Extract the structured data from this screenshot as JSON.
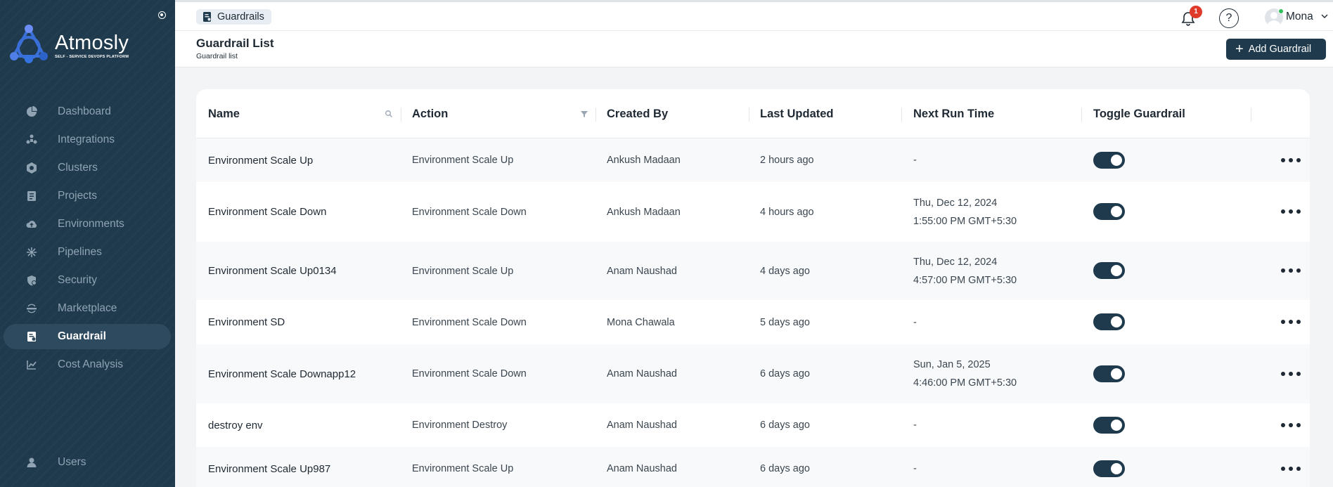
{
  "brand": {
    "name": "Atmosly",
    "tagline": "SELF - SERVICE DEVOPS PLATFORM"
  },
  "sidebar": {
    "items": [
      {
        "label": "Dashboard",
        "icon": "dashboard-icon"
      },
      {
        "label": "Integrations",
        "icon": "integrations-icon"
      },
      {
        "label": "Clusters",
        "icon": "clusters-icon"
      },
      {
        "label": "Projects",
        "icon": "projects-icon"
      },
      {
        "label": "Environments",
        "icon": "environments-icon"
      },
      {
        "label": "Pipelines",
        "icon": "pipelines-icon"
      },
      {
        "label": "Security",
        "icon": "security-icon"
      },
      {
        "label": "Marketplace",
        "icon": "marketplace-icon"
      },
      {
        "label": "Guardrail",
        "icon": "guardrail-icon",
        "active": true
      },
      {
        "label": "Cost Analysis",
        "icon": "cost-analysis-icon"
      }
    ],
    "bottom_items": [
      {
        "label": "Users",
        "icon": "users-icon"
      }
    ]
  },
  "topbar": {
    "breadcrumb": "Guardrails",
    "notification_count": "1",
    "help": "?",
    "user_name": "Mona"
  },
  "header": {
    "title": "Guardrail List",
    "subtitle": "Guardrail list",
    "add_button": "Add Guardrail"
  },
  "table": {
    "columns": [
      "Name",
      "Action",
      "Created By",
      "Last Updated",
      "Next Run Time",
      "Toggle Guardrail"
    ],
    "rows": [
      {
        "name": "Environment Scale Up",
        "action": "Environment Scale Up",
        "created_by": "Ankush Madaan",
        "last_updated": "2 hours ago",
        "next_run": [
          "-"
        ],
        "enabled": true
      },
      {
        "name": "Environment Scale Down",
        "action": "Environment Scale Down",
        "created_by": "Ankush Madaan",
        "last_updated": "4 hours ago",
        "next_run": [
          "Thu, Dec 12, 2024",
          "1:55:00 PM GMT+5:30"
        ],
        "enabled": true
      },
      {
        "name": "Environment Scale Up0134",
        "action": "Environment Scale Up",
        "created_by": "Anam Naushad",
        "last_updated": "4 days ago",
        "next_run": [
          "Thu, Dec 12, 2024",
          "4:57:00 PM GMT+5:30"
        ],
        "enabled": true
      },
      {
        "name": "Environment SD",
        "action": "Environment Scale Down",
        "created_by": "Mona Chawala",
        "last_updated": "5 days ago",
        "next_run": [
          "-"
        ],
        "enabled": true
      },
      {
        "name": "Environment Scale Downapp12",
        "action": "Environment Scale Down",
        "created_by": "Anam Naushad",
        "last_updated": "6 days ago",
        "next_run": [
          "Sun, Jan 5, 2025",
          "4:46:00 PM GMT+5:30"
        ],
        "enabled": true
      },
      {
        "name": "destroy env",
        "action": "Environment Destroy",
        "created_by": "Anam Naushad",
        "last_updated": "6 days ago",
        "next_run": [
          "-"
        ],
        "enabled": true
      },
      {
        "name": "Environment Scale Up987",
        "action": "Environment Scale Up",
        "created_by": "Anam Naushad",
        "last_updated": "6 days ago",
        "next_run": [
          "-"
        ],
        "enabled": true
      }
    ]
  },
  "colors": {
    "sidebar_bg": "#1f3a4d",
    "accent": "#1f3a4d",
    "badge": "#e03a2b",
    "online": "#2fbf5b"
  }
}
